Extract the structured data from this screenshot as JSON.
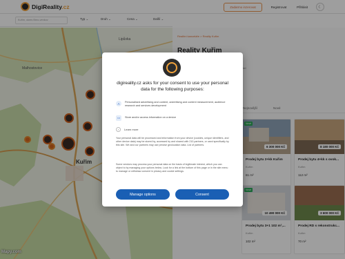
{
  "header": {
    "logo_text": "DigiReality",
    "logo_suffix": ".cz",
    "outline_button": "Zadarmo inzerovat",
    "link_register": "Registrovat",
    "link_login": "Přihlásit",
    "theme_icon": "moon-icon"
  },
  "filters": {
    "search_placeholder": "Kuřim, okres Brno-venkov",
    "drop1": "Typ",
    "drop2": "Druh",
    "drop3": "Cena",
    "drop4": "Další"
  },
  "map": {
    "city": "Kuřim",
    "label1": "Lipůvka",
    "label2": "Malhostovice",
    "attribution": "Mapy.com"
  },
  "panel": {
    "breadcrumb": "Realitní kanceláře  >  Reality Kuřim",
    "title": "Reality Kuřim",
    "meta": "Kuřim · Brno-venkov · 664 34 · 53 km² · 11 200 obyvatel",
    "sub": "Prodej · Pronájem",
    "tab1": "Nejnovější",
    "tab2": "Nové",
    "cards": [
      {
        "price": "6 300 000 Kč",
        "title": "Prodej bytu 2+kk Kuřim",
        "loc": "Kuřim",
        "area": "61 m²",
        "badge": "Nové"
      },
      {
        "price": "8 180 000 Kč",
        "title": "Prodej bytu 4+kk s ovok...",
        "loc": "Kuřim",
        "area": "112 m²",
        "badge": ""
      },
      {
        "price": "10 490 000 Kč",
        "title": "Prodej bytu 3+1 102 m²,...",
        "loc": "Kuřim",
        "area": "102 m²",
        "badge": "Nové"
      },
      {
        "price": "3 600 000 Kč",
        "title": "Prodej RD s rekonstrukc...",
        "loc": "Kuřim",
        "area": "70 m²",
        "badge": ""
      }
    ]
  },
  "dialog": {
    "title": "digireality.cz asks for your consent to use your personal data for the following purposes:",
    "purpose1": "Personalised advertising and content, advertising and content measurement, audience research and services development",
    "purpose2": "Store and/or access information on a device",
    "learn_more": "Learn more",
    "para1": "Your personal data will be processed and information from your device (cookies, unique identifiers, and other device data) may be stored by, accessed by and shared with 210 partners, or used specifically by this site. We and our partners may use precise geolocation data. List of partners.",
    "para2": "Some vendors may process your personal data on the basis of legitimate interest, which you can object to by managing your options below. Look for a link at the bottom of this page or in the site menu to manage or withdraw consent in privacy and cookie settings.",
    "manage_button": "Manage options",
    "consent_button": "Consent"
  }
}
